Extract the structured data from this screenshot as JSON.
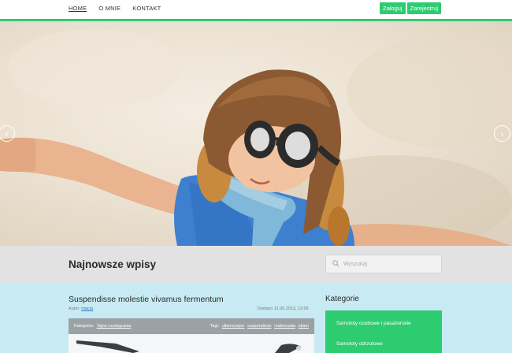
{
  "nav": {
    "items": [
      {
        "label": "HOME",
        "active": true
      },
      {
        "label": "O MNIE",
        "active": false
      },
      {
        "label": "KONTAKT",
        "active": false
      }
    ]
  },
  "auth": {
    "login": "Zaloguj",
    "register": "Zarejestruj"
  },
  "colors": {
    "accent": "#2ecc71",
    "band": "#e2e2e2",
    "content_bg": "#c8eaf2",
    "meta_bar": "#9aa2a6"
  },
  "slider": {
    "prev_icon": "chevron-left-icon",
    "next_icon": "chevron-right-icon"
  },
  "latest": {
    "heading": "Najnowsze wpisy"
  },
  "search": {
    "placeholder": "Wyszukaj",
    "icon": "search-icon"
  },
  "post": {
    "title": "Suspendisse molestie vivamus fermentum",
    "author_label": "Autor:",
    "author": "maciq",
    "date": "Dodano 11.05.2013, 13:05",
    "category_label": "Kategoria:",
    "category": "Tajne rozwiązania",
    "tags_label": "Tagi:",
    "tags": [
      "ullamcorper",
      "suspendisse",
      "malesuada",
      "etiam"
    ]
  },
  "sidebar": {
    "title": "Kategorie",
    "categories": [
      "Samoloty osobowe i pasażerskie",
      "Samoloty odrzutowe"
    ]
  }
}
